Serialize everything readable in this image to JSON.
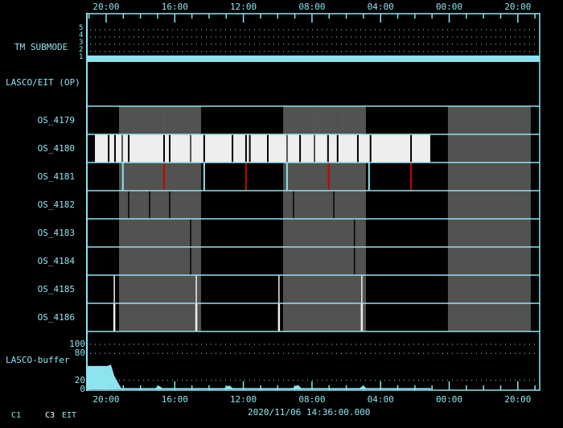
{
  "colors": {
    "axis": "#8ee4ee",
    "band": "#525252",
    "white_bar": "#eeeeee",
    "red": "#cc0000",
    "tick_gray": "#555555"
  },
  "time_axis": {
    "labels": [
      "20:00",
      "16:00",
      "12:00",
      "08:00",
      "04:00",
      "00:00",
      "20:00"
    ],
    "span_hours": 26.4,
    "first_label_hour": 1.125,
    "hours_per_label": 4
  },
  "tm_submode": {
    "label": "TM SUBMODE",
    "levels": [
      "1",
      "2",
      "3",
      "4",
      "5"
    ],
    "current_level": 1
  },
  "lasco_eit": {
    "label": "LASCO/EIT (OP)"
  },
  "rows": [
    {
      "label": "OS_4179"
    },
    {
      "label": "OS_4180"
    },
    {
      "label": "OS_4181"
    },
    {
      "label": "OS_4182"
    },
    {
      "label": "OS_4183"
    },
    {
      "label": "OS_4184"
    },
    {
      "label": "OS_4185"
    },
    {
      "label": "OS_4186"
    }
  ],
  "bands_hours": [
    [
      1.875,
      6.66
    ],
    [
      11.44,
      16.27
    ],
    [
      21.05,
      25.88
    ]
  ],
  "events": {
    "os4179_gray": [
      2.06,
      3.66,
      4.5,
      6.05,
      6.42,
      11.67,
      12.05,
      13.27,
      13.55,
      14.06,
      14.9,
      16.03
    ],
    "os4180_white": [
      0.47,
      20.02
    ],
    "os4180_black": [
      1.27,
      1.64,
      2.44,
      4.5,
      4.83,
      6.84,
      8.49,
      9.28,
      9.5,
      10.55,
      12.43,
      14.06,
      14.62,
      15.8,
      16.54,
      18.9
    ],
    "os4180_gray": [
      2.06,
      6.05,
      11.67,
      13.27
    ],
    "os4181_cyan": [
      2.1,
      6.84,
      11.67,
      16.45
    ],
    "os4181_red": [
      4.5,
      9.28,
      14.1,
      18.9
    ],
    "os4182_black": [
      2.44,
      3.66,
      4.83,
      12.05,
      14.4
    ],
    "os4183_black": [
      6.05,
      15.6
    ],
    "os4184_black": [
      6.05,
      15.6
    ],
    "os4185_white": [
      1.6,
      6.38,
      11.2,
      16.03
    ],
    "os4186_white": [
      1.6,
      6.38,
      11.2,
      16.03
    ]
  },
  "buffer": {
    "label": "LASCO-buffer",
    "yticks": [
      "100",
      "80",
      "20",
      "0"
    ],
    "ymax": 100,
    "series": [
      [
        0,
        52
      ],
      [
        1.2,
        52
      ],
      [
        1.4,
        55
      ],
      [
        1.6,
        30
      ],
      [
        2.0,
        3
      ],
      [
        4.0,
        3
      ],
      [
        4.2,
        8
      ],
      [
        4.4,
        3
      ],
      [
        8.0,
        3
      ],
      [
        8.3,
        9
      ],
      [
        8.5,
        3
      ],
      [
        12.0,
        3
      ],
      [
        12.3,
        10
      ],
      [
        12.5,
        3
      ],
      [
        15.9,
        3
      ],
      [
        16.1,
        8
      ],
      [
        16.3,
        3
      ],
      [
        20.06,
        3
      ]
    ]
  },
  "footer": {
    "c1": "C1",
    "c3": "C3",
    "eit": "EIT",
    "timestamp": "2020/11/06 14:36:00.000"
  }
}
